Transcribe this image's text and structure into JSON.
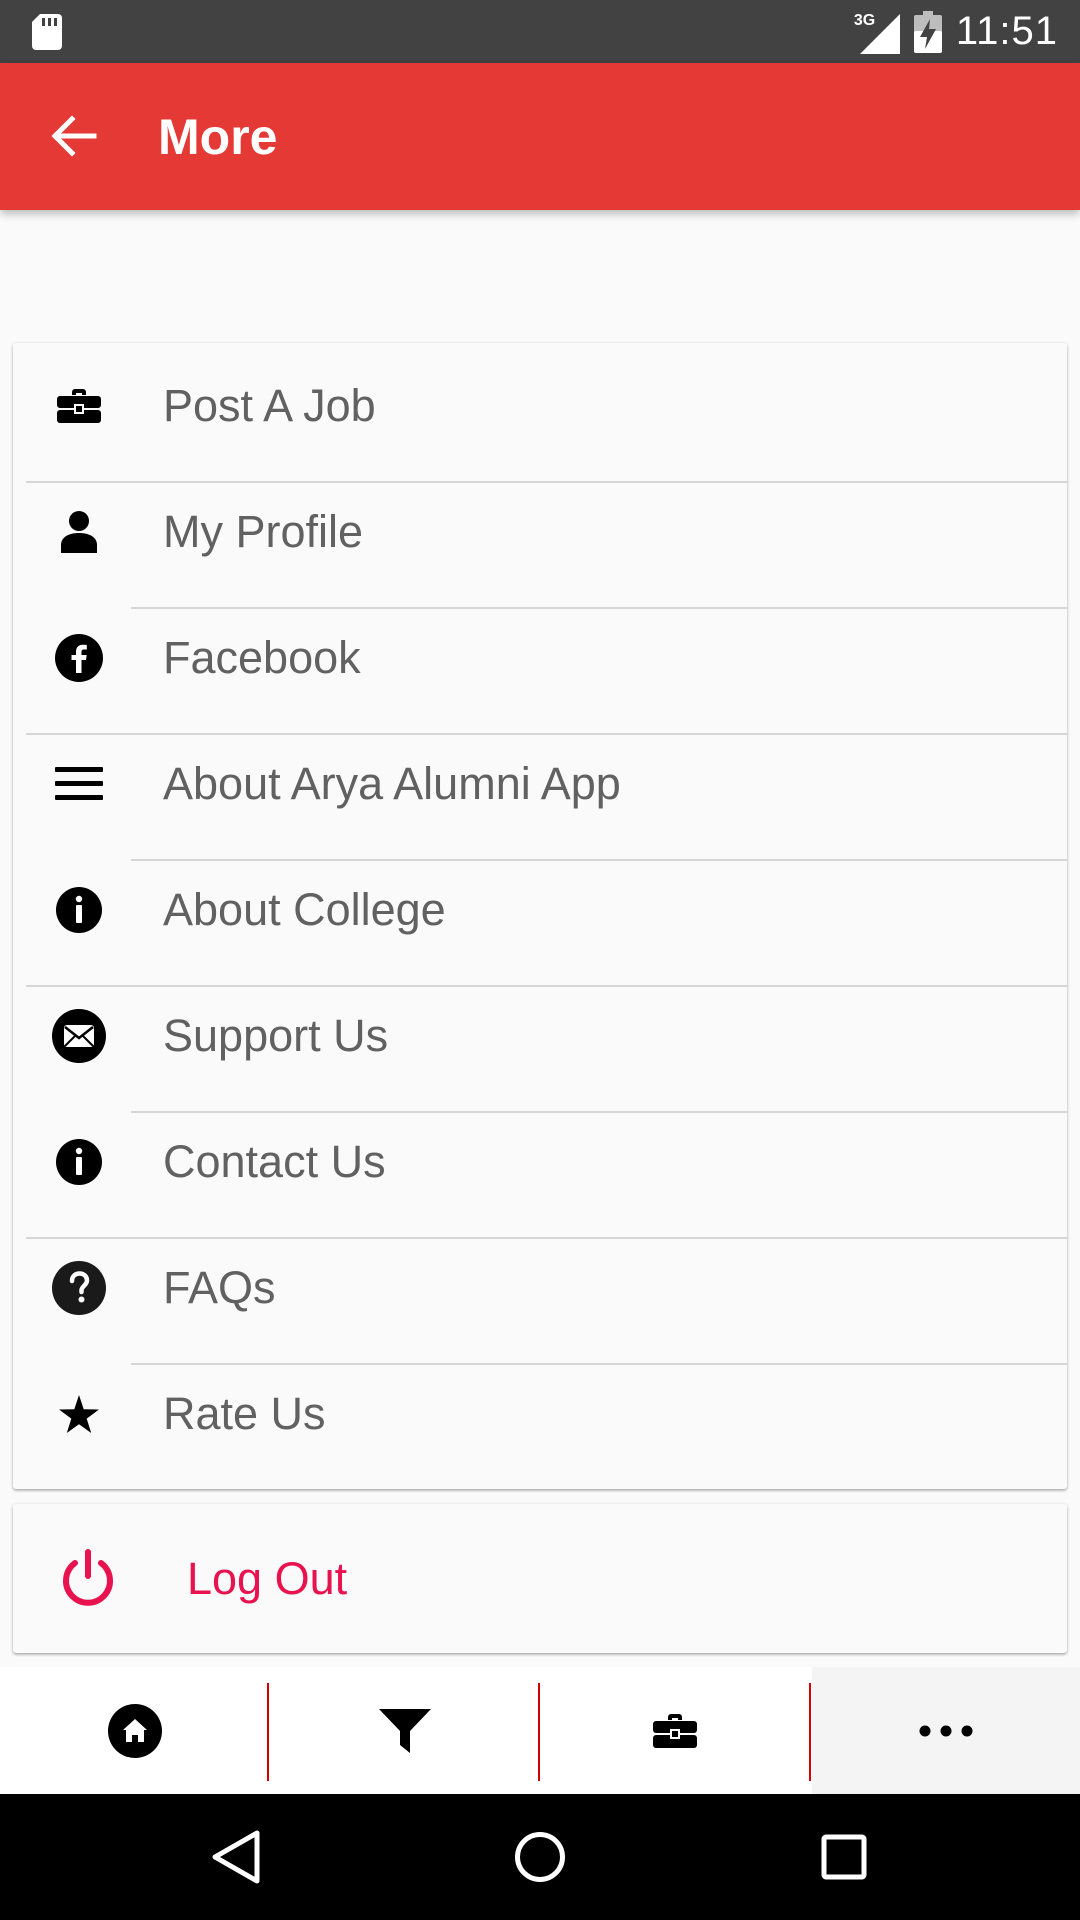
{
  "status_bar": {
    "network": "3G",
    "time": "11:51"
  },
  "app_bar": {
    "title": "More",
    "back_icon": "arrow-back-icon"
  },
  "menu": {
    "items": [
      {
        "label": "Post A Job",
        "icon": "briefcase-icon"
      },
      {
        "label": "My Profile",
        "icon": "person-icon"
      },
      {
        "label": "Facebook",
        "icon": "facebook-icon"
      },
      {
        "label": "About Arya Alumni App",
        "icon": "menu-lines-icon"
      },
      {
        "label": "About College",
        "icon": "info-icon"
      },
      {
        "label": "Support Us",
        "icon": "mail-circle-icon"
      },
      {
        "label": "Contact Us",
        "icon": "info-icon"
      },
      {
        "label": "FAQs",
        "icon": "help-circle-icon"
      },
      {
        "label": "Rate Us",
        "icon": "star-icon"
      }
    ]
  },
  "logout": {
    "label": "Log Out",
    "icon": "power-icon",
    "color": "#e8124f"
  },
  "bottom_nav": {
    "tabs": [
      {
        "icon": "home-icon",
        "active": false
      },
      {
        "icon": "filter-icon",
        "active": false
      },
      {
        "icon": "briefcase-icon",
        "active": false
      },
      {
        "icon": "more-dots-icon",
        "active": true
      }
    ]
  },
  "colors": {
    "app_bar": "#e53935",
    "status_bar": "#424242",
    "tab_separator": "#d50000"
  }
}
